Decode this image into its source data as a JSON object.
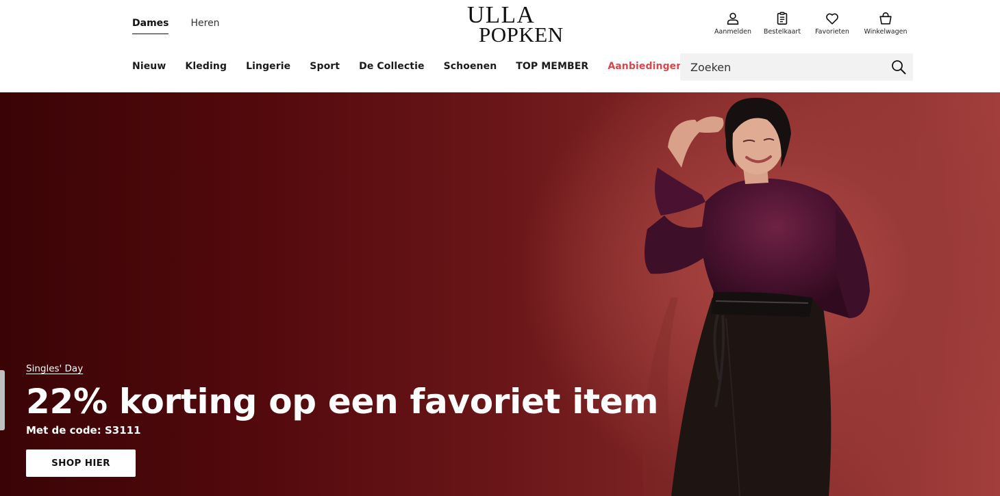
{
  "header": {
    "gender_tabs": [
      {
        "label": "Dames",
        "active": true
      },
      {
        "label": "Heren",
        "active": false
      }
    ],
    "logo": {
      "line1": "ULLA",
      "line2": "POPKEN"
    },
    "account": [
      {
        "label": "Aanmelden",
        "icon": "user-icon"
      },
      {
        "label": "Bestelkaart",
        "icon": "order-card-icon"
      },
      {
        "label": "Favorieten",
        "icon": "heart-icon"
      },
      {
        "label": "Winkelwagen",
        "icon": "shopping-bag-icon"
      }
    ],
    "nav": [
      {
        "label": "Nieuw"
      },
      {
        "label": "Kleding"
      },
      {
        "label": "Lingerie"
      },
      {
        "label": "Sport"
      },
      {
        "label": "De Collectie"
      },
      {
        "label": "Schoenen"
      },
      {
        "label": "TOP MEMBER"
      },
      {
        "label": "Aanbiedingen",
        "color": "#d9474c"
      }
    ],
    "search": {
      "placeholder": "Zoeken",
      "icon": "search-icon"
    }
  },
  "hero": {
    "eyebrow": "Singles' Day",
    "headline": "22% korting op een favoriet item",
    "subline": "Met de code: S3111",
    "cta": "SHOP HIER",
    "background_color": "#6a1618"
  }
}
